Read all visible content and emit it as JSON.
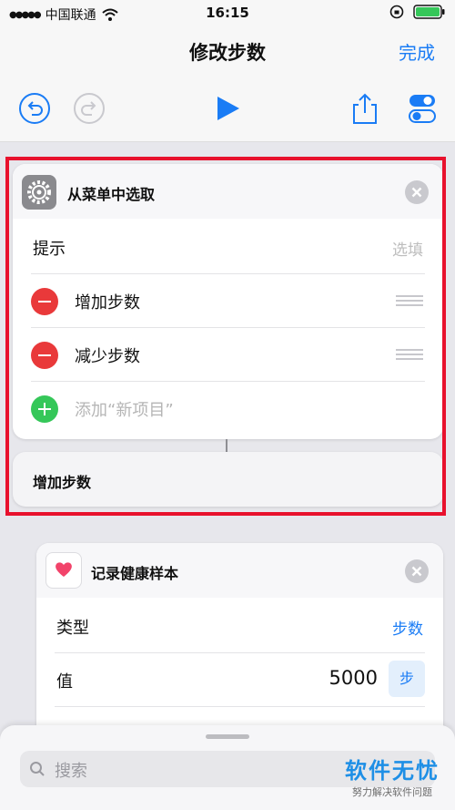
{
  "status_bar": {
    "carrier": "中国联通",
    "time": "16:15"
  },
  "nav": {
    "title": "修改步数",
    "done_label": "完成"
  },
  "menu_card": {
    "title": "从菜单中选取",
    "prompt_label": "提示",
    "prompt_placeholder": "选填",
    "items": [
      {
        "label": "增加步数"
      },
      {
        "label": "减少步数"
      }
    ],
    "add_item_label": "添加“新项目”"
  },
  "branch_card": {
    "label": "增加步数"
  },
  "health_card": {
    "title": "记录健康样本",
    "type_label": "类型",
    "type_value": "步数",
    "value_label": "值",
    "value": "5000",
    "unit": "步"
  },
  "search": {
    "placeholder": "搜索"
  },
  "watermark": {
    "main": "软件无忧",
    "sub": "努力解决软件问题"
  },
  "colors": {
    "accent": "#1a7cf5",
    "highlight": "#e8112d",
    "delete": "#e9393a",
    "add": "#35c759"
  },
  "icons": [
    "undo-icon",
    "redo-icon",
    "play-icon",
    "share-icon",
    "settings-toggle-icon",
    "gear-icon",
    "close-icon",
    "heart-icon",
    "search-icon"
  ]
}
